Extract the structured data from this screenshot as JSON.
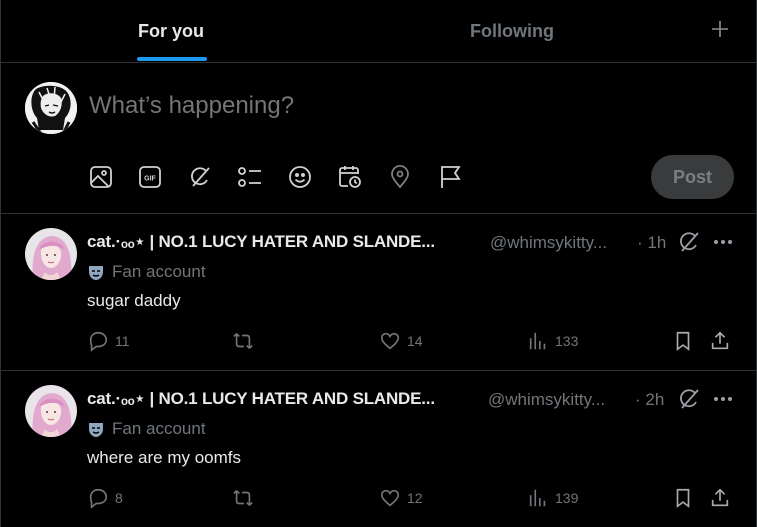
{
  "tabs": [
    {
      "label": "For you",
      "active": true
    },
    {
      "label": "Following",
      "active": false
    }
  ],
  "add_tab_icon": "plus-icon",
  "accent": "#1d9bf0",
  "composer": {
    "placeholder": "What’s happening?",
    "post_label": "Post",
    "toolbar_icons": [
      "image-icon",
      "gif-icon",
      "grok-icon",
      "poll-icon",
      "emoji-icon",
      "schedule-icon",
      "location-icon",
      "flag-icon"
    ]
  },
  "tweets": [
    {
      "name": "cat.·ₒₒ⋆ | NO.1 LUCY HATER AND SLANDE...",
      "handle": "@whimsykitty...",
      "time": "· 1h",
      "badge_label": "Fan account",
      "text": "sugar daddy",
      "replies": "11",
      "reposts": "",
      "likes": "14",
      "views": "133"
    },
    {
      "name": "cat.·ₒₒ⋆ | NO.1 LUCY HATER AND SLANDE...",
      "handle": "@whimsykitty...",
      "time": "· 2h",
      "badge_label": "Fan account",
      "text": "where are my oomfs",
      "replies": "8",
      "reposts": "",
      "likes": "12",
      "views": "139"
    }
  ]
}
